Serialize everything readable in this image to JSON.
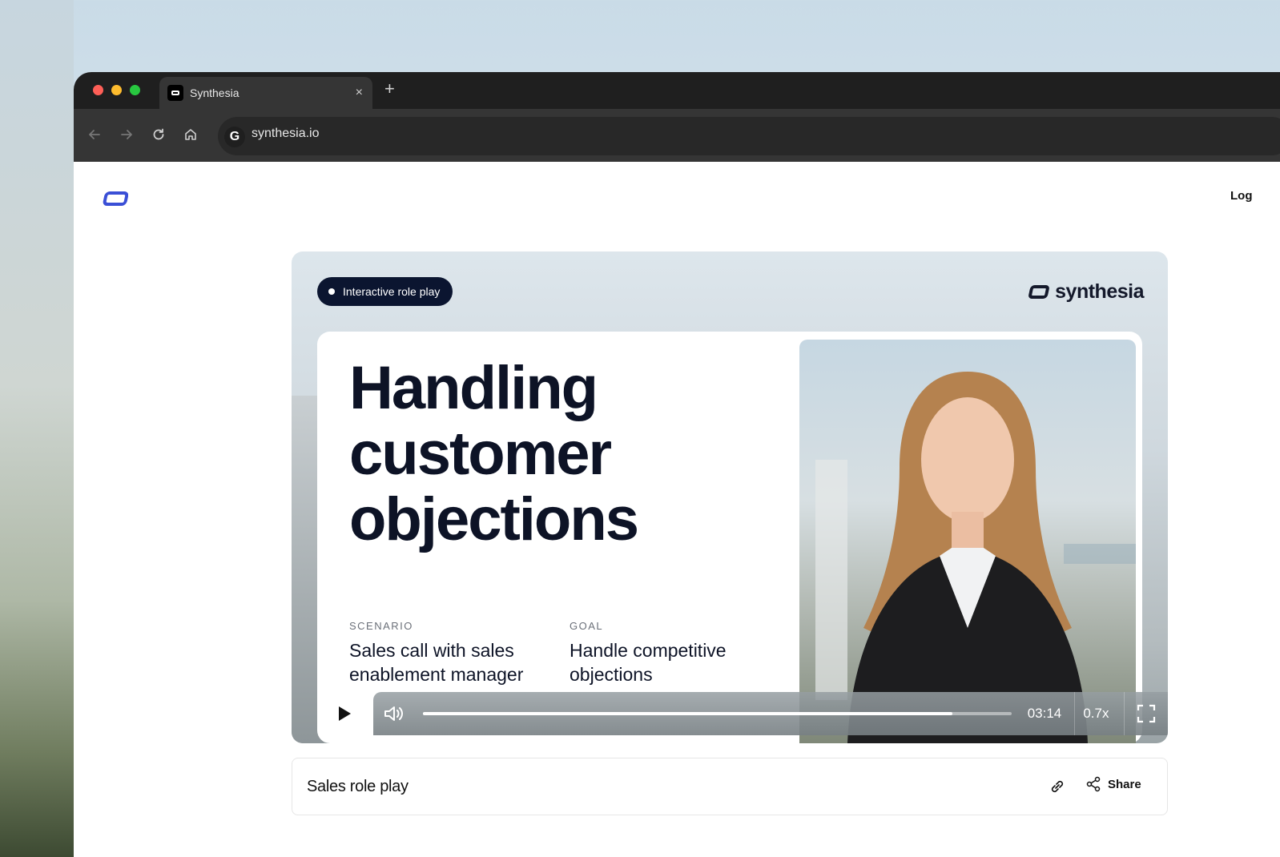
{
  "browser": {
    "tab_title": "Synthesia",
    "tab_close": "×",
    "new_tab": "+",
    "url": "synthesia.io",
    "url_icon_letter": "G"
  },
  "header": {
    "login_label": "Log"
  },
  "player": {
    "badge_label": "Interactive role play",
    "brand_name": "synthesia",
    "headline": "Handling customer objections",
    "scenario_label": "SCENARIO",
    "scenario_value": "Sales call with sales enablement manager",
    "goal_label": "GOAL",
    "goal_value": "Handle competitive objections",
    "time": "03:14",
    "speed": "0.7x",
    "progress_fraction": 0.9
  },
  "info": {
    "title": "Sales role play",
    "share_label": "Share"
  },
  "colors": {
    "brand_blue": "#3a4fd6",
    "dark_navy": "#0d1326",
    "chrome_dark": "#1f1f1f"
  }
}
